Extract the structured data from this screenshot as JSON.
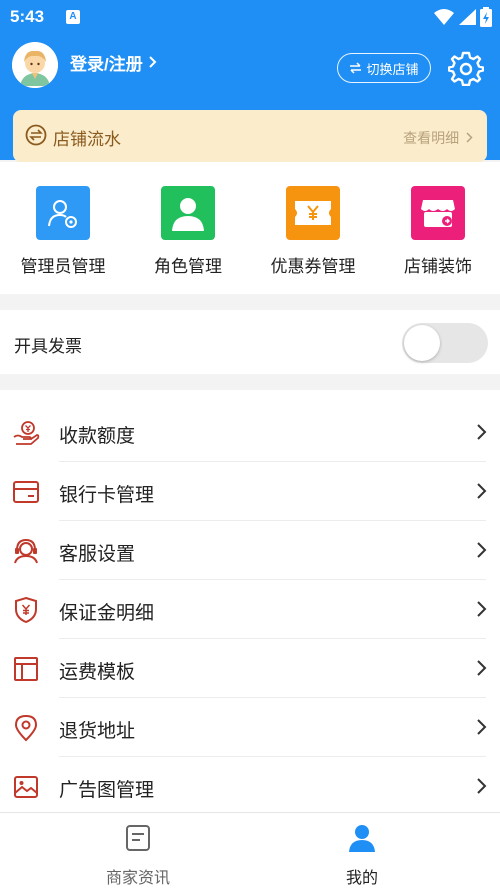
{
  "status_bar": {
    "time": "5:43",
    "notification_icon": "A",
    "icons": [
      "wifi-icon",
      "signal-icon",
      "battery-icon"
    ]
  },
  "header": {
    "login_label": "登录/注册",
    "switch_store_label": "切换店铺",
    "settings_icon": "gear-icon",
    "background_color": "#1f8ff5"
  },
  "store_flow": {
    "title": "店铺流水",
    "link_label": "查看明细"
  },
  "quick_actions": [
    {
      "label": "管理员管理",
      "icon": "admin-user-icon",
      "color": "#2f9af5"
    },
    {
      "label": "角色管理",
      "icon": "role-person-icon",
      "color": "#22c05c"
    },
    {
      "label": "优惠券管理",
      "icon": "coupon-icon",
      "color": "#f6930f"
    },
    {
      "label": "店铺装饰",
      "icon": "store-decor-icon",
      "color": "#ec1f7a"
    }
  ],
  "invoice": {
    "label": "开具发票",
    "enabled": false
  },
  "menu": [
    {
      "label": "收款额度",
      "icon": "payment-limit-icon"
    },
    {
      "label": "银行卡管理",
      "icon": "bank-card-icon"
    },
    {
      "label": "客服设置",
      "icon": "customer-service-icon"
    },
    {
      "label": "保证金明细",
      "icon": "deposit-shield-icon"
    },
    {
      "label": "运费模板",
      "icon": "shipping-template-icon"
    },
    {
      "label": "退货地址",
      "icon": "location-pin-icon"
    },
    {
      "label": "广告图管理",
      "icon": "ad-image-icon"
    }
  ],
  "tabbar": {
    "tabs": [
      {
        "label": "商家资讯",
        "icon": "news-icon",
        "active": false
      },
      {
        "label": "我的",
        "icon": "profile-icon",
        "active": true
      }
    ]
  },
  "colors": {
    "accent": "#1f8ff5",
    "menu_icon": "#c0392b",
    "flow_bg": "#fbeccb"
  }
}
